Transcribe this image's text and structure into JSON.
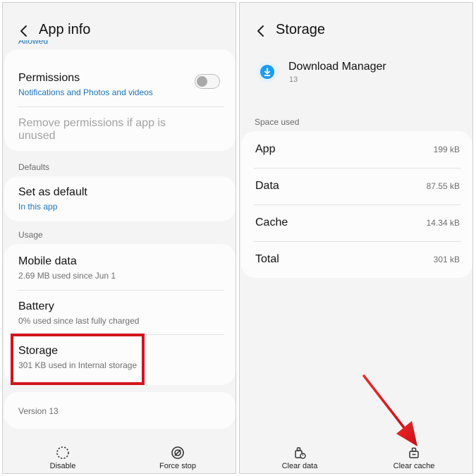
{
  "left": {
    "header": {
      "title": "App info"
    },
    "cut_text": "Allowed",
    "permissions": {
      "title": "Permissions",
      "subtitle": "Notifications and Photos and videos"
    },
    "remove_permissions": {
      "title": "Remove permissions if app is unused",
      "toggle_on": false
    },
    "defaults": {
      "label": "Defaults",
      "set_as_default": {
        "title": "Set as default",
        "subtitle": "In this app"
      }
    },
    "usage": {
      "label": "Usage",
      "items": [
        {
          "title": "Mobile data",
          "subtitle": "2.69 MB used since Jun 1"
        },
        {
          "title": "Battery",
          "subtitle": "0% used since last fully charged"
        },
        {
          "title": "Storage",
          "subtitle": "301 KB used in Internal storage"
        }
      ]
    },
    "version": "Version 13",
    "bottom_bar": {
      "disable": "Disable",
      "force_stop": "Force stop"
    }
  },
  "right": {
    "header": {
      "title": "Storage"
    },
    "app": {
      "name": "Download Manager",
      "version": "13",
      "icon": "download-icon"
    },
    "space_used": {
      "label": "Space used",
      "rows": [
        {
          "key": "App",
          "value": "199 kB"
        },
        {
          "key": "Data",
          "value": "87.55 kB"
        },
        {
          "key": "Cache",
          "value": "14.34 kB"
        },
        {
          "key": "Total",
          "value": "301 kB"
        }
      ]
    },
    "bottom_bar": {
      "clear_data": "Clear data",
      "clear_cache": "Clear cache"
    }
  },
  "colors": {
    "accent": "#1a73c2",
    "highlight": "#d3141b",
    "app_icon": "#1e9bf0"
  }
}
